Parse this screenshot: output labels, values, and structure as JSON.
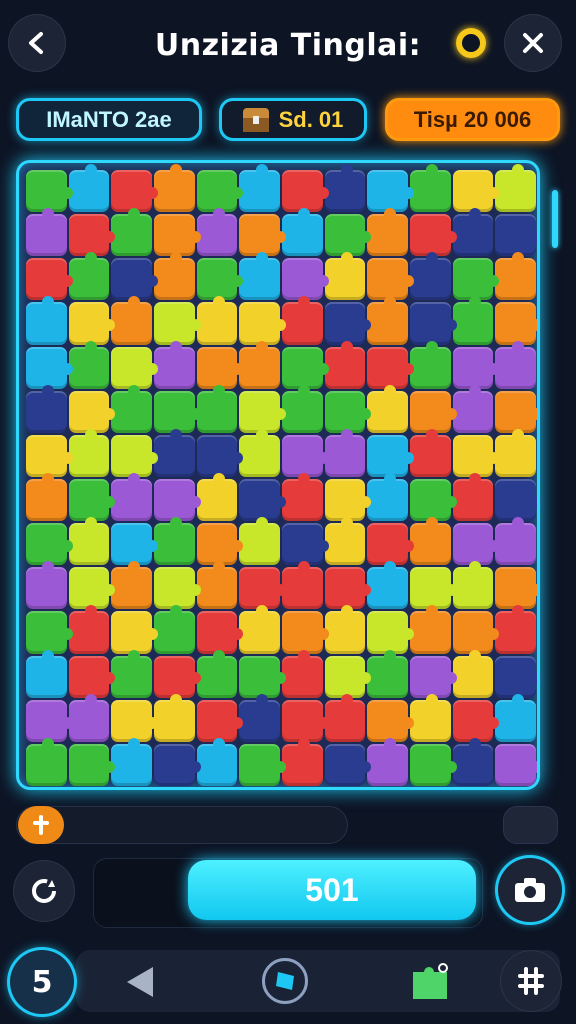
{
  "header": {
    "title": "Unzizia Tinglai:",
    "back_icon": "chevron-left-icon",
    "close_icon": "close-icon",
    "coin_icon": "coin-icon",
    "coin_color": "#f7c81c"
  },
  "stats": {
    "mode_label": "IMaNTO 2ae",
    "score_label": "Sd. 01",
    "time_label": "Tisµ 20 006"
  },
  "board": {
    "rows": 14,
    "cols": 12,
    "palette": [
      "#e63b3b",
      "#f28a1c",
      "#f2d22a",
      "#3bbf3b",
      "#1fb4e8",
      "#9b59d6",
      "#c8e62a",
      "#2a3c8f"
    ],
    "border_color": "#2fd8ff"
  },
  "progress": {
    "icon": "plus-icon",
    "value": 0
  },
  "actions": {
    "rotate_icon": "rotate-icon",
    "main_button_label": "501",
    "camera_icon": "camera-icon"
  },
  "bottom_nav": {
    "level_label": "5",
    "prev_icon": "triangle-left-icon",
    "gem_icon": "gem-icon",
    "puzzle_icon": "puzzle-piece-icon",
    "tools_icon": "tools-icon"
  },
  "colors": {
    "accent": "#1ec8f4",
    "warning": "#ff8b0f",
    "background": "#0d1424"
  }
}
